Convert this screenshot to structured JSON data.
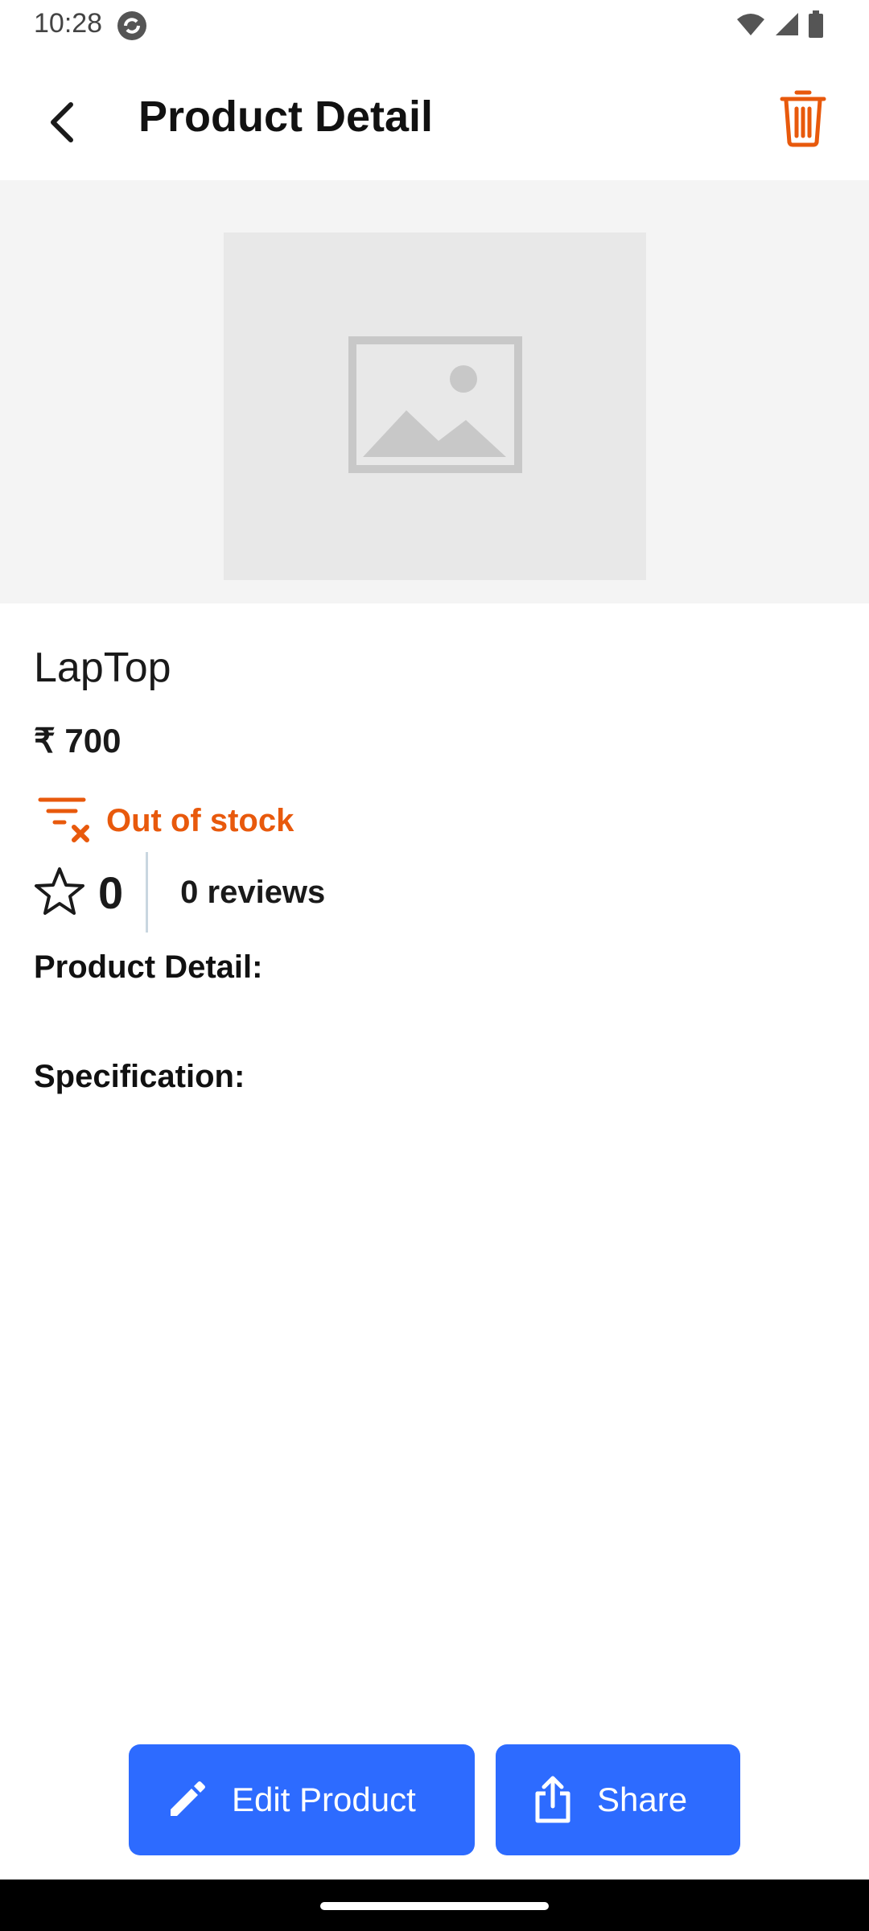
{
  "status_bar": {
    "time": "10:28"
  },
  "header": {
    "title": "Product Detail",
    "back_icon": "arrow-back-icon",
    "delete_icon": "trash-icon"
  },
  "product": {
    "image_icon": "image-placeholder-icon",
    "name": "LapTop",
    "price": "₹ 700",
    "stock_status": "Out of stock",
    "rating": "0",
    "reviews": "0 reviews",
    "detail_label": "Product Detail:",
    "specification_label": "Specification:"
  },
  "actions": {
    "edit_label": "Edit Product",
    "share_label": "Share"
  },
  "colors": {
    "accent": "#e8590c",
    "button": "#2d6bff"
  }
}
